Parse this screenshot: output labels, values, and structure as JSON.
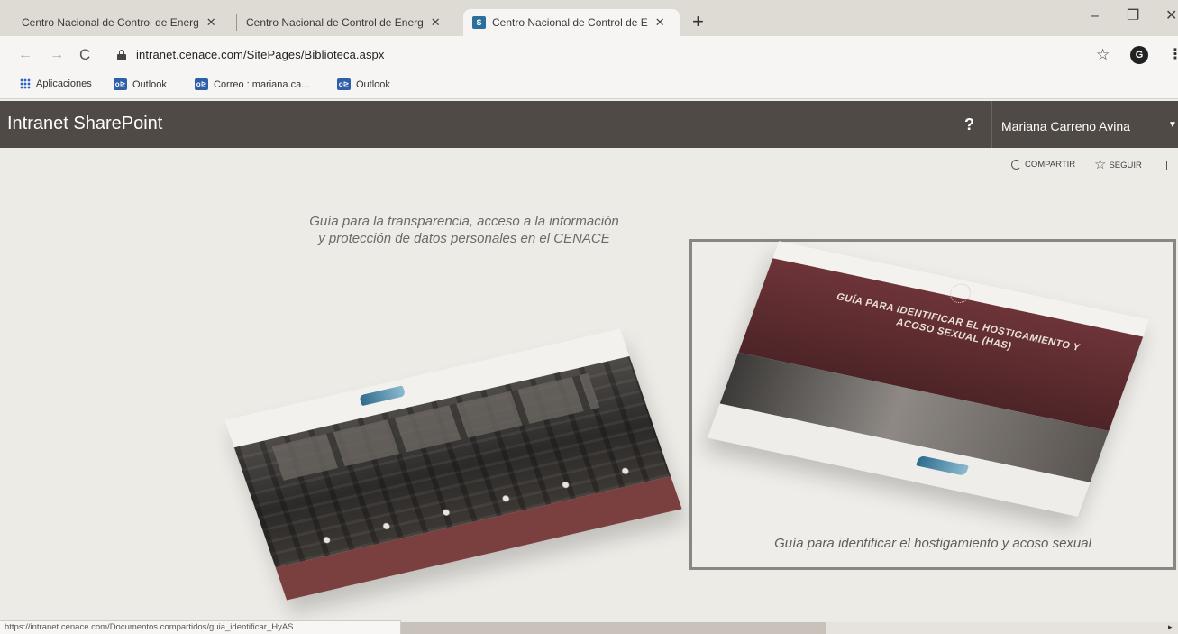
{
  "browser": {
    "tabs": [
      {
        "title": "Centro Nacional de Control de Energ",
        "close": "✕"
      },
      {
        "title": "Centro Nacional de Control de Energ",
        "close": "✕"
      },
      {
        "title": "Centro Nacional de Control de E",
        "close": "✕",
        "favicon": "S",
        "active": true
      }
    ],
    "new_tab": "+",
    "window": {
      "minimize": "–",
      "maximize": "❐",
      "close": "✕"
    },
    "nav": {
      "back": "←",
      "forward": "→",
      "reload": "C"
    },
    "url": "intranet.cenace.com/SitePages/Biblioteca.aspx",
    "star": "☆",
    "avatar_letter": "G",
    "menu": "⋮",
    "bookmarks": [
      {
        "label": "Aplicaciones",
        "icon": "apps-grid-icon"
      },
      {
        "label": "Outlook",
        "icon": "outlook-icon",
        "badge": "o⊵"
      },
      {
        "label": "Correo : mariana.ca...",
        "icon": "outlook-icon",
        "badge": "o⊵"
      },
      {
        "label": "Outlook",
        "icon": "outlook-icon",
        "badge": "o⊵"
      }
    ],
    "status_url": "https://intranet.cenace.com/Documentos compartidos/guia_identificar_HyAS..."
  },
  "sharepoint": {
    "title": "Intranet SharePoint",
    "help": "?",
    "user": "Mariana Carreno Avina",
    "caret": "▼",
    "actions": {
      "share": "COMPARTIR",
      "follow": "SEGUIR"
    }
  },
  "library": {
    "item1": {
      "caption_line1": "Guía para la transparencia, acceso a la información",
      "caption_line2": "y protección de datos personales en el CENACE"
    },
    "item2": {
      "cover_title": "GUÍA PARA IDENTIFICAR EL HOSTIGAMIENTO Y ACOSO SEXUAL (HAS)",
      "caption": "Guía para identificar el hostigamiento y acoso sexual"
    }
  },
  "colors": {
    "suitebar": "#4f4a45",
    "accent_cover": "#6d3438",
    "page_bg": "#edebe6"
  }
}
